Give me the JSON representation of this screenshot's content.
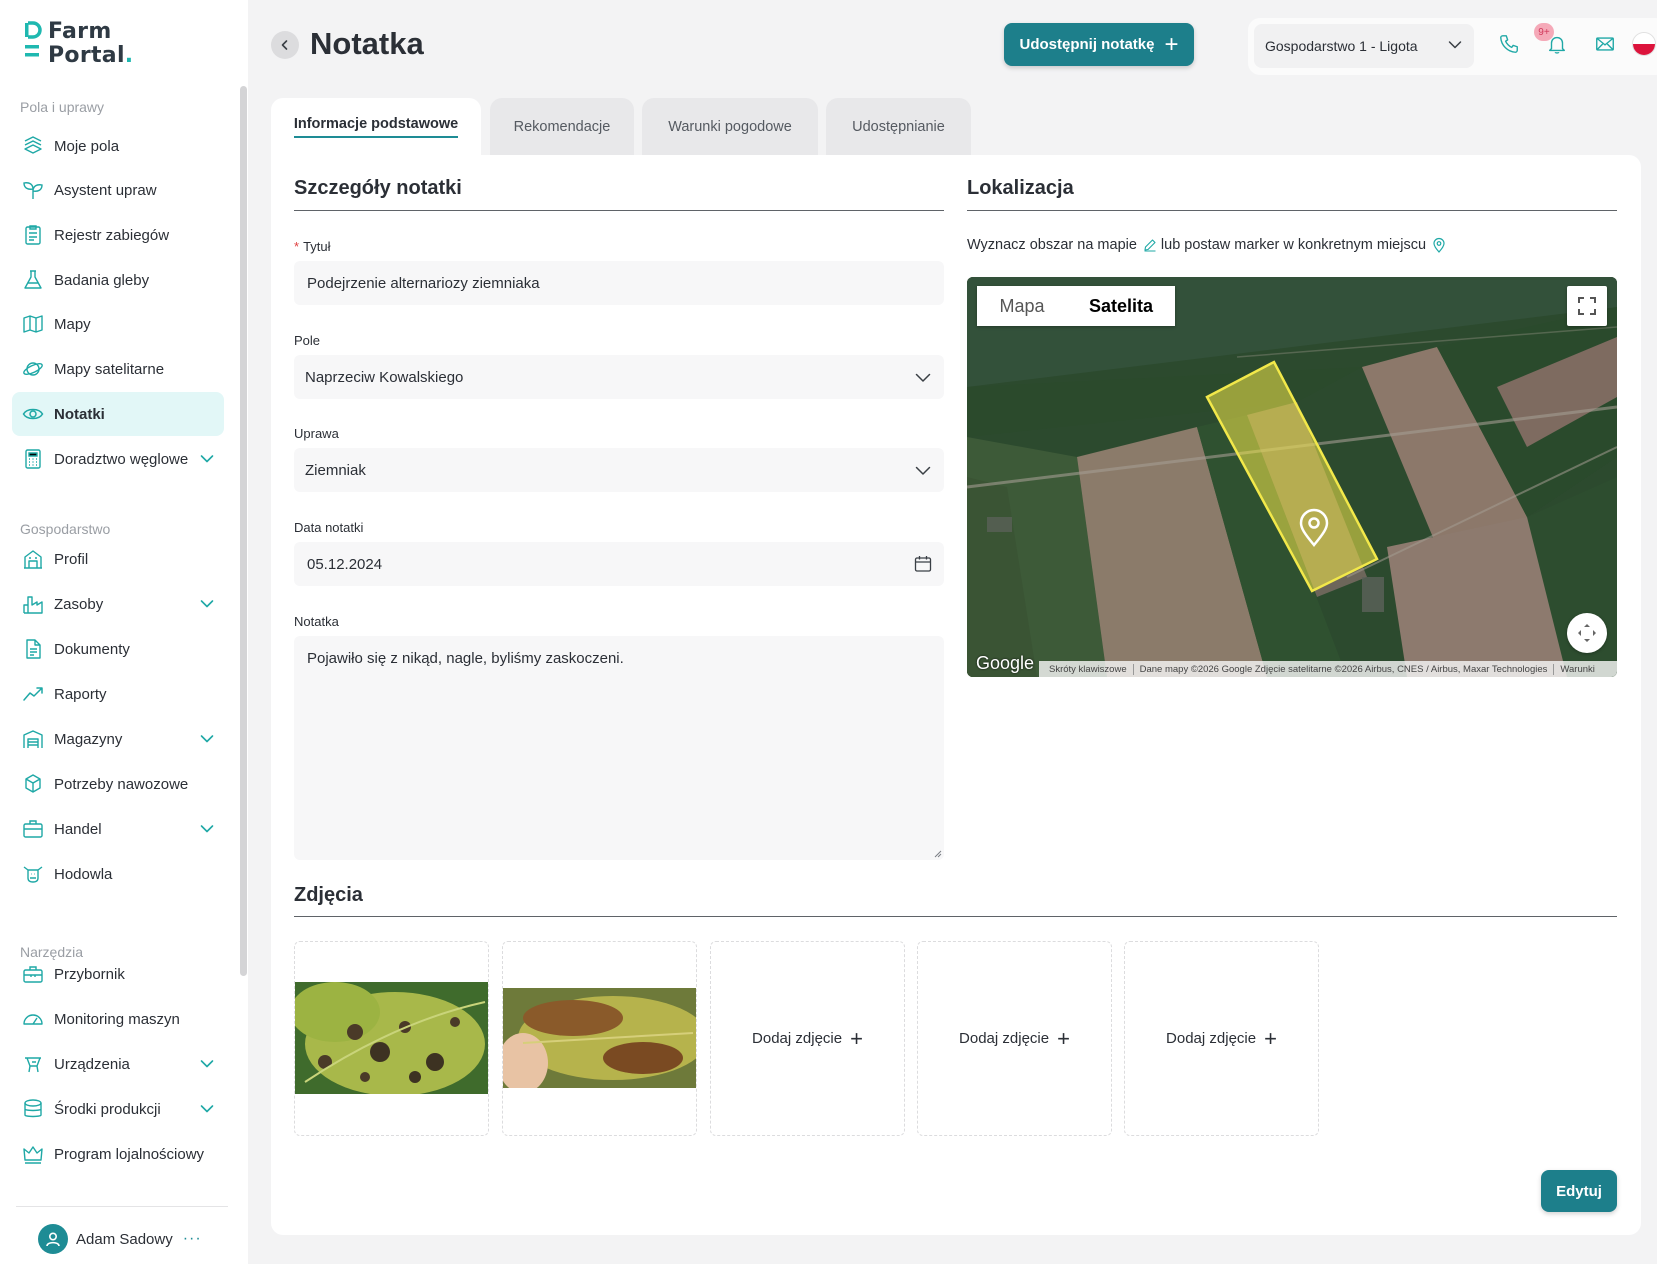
{
  "brand": {
    "line1": "Farm",
    "line2": "Portal",
    "dot": ".",
    "accent": "#1fb8b0",
    "primary": "#1d7f8b"
  },
  "sidebar": {
    "sections": [
      {
        "label": "Pola i uprawy"
      },
      {
        "label": "Gospodarstwo"
      },
      {
        "label": "Narzędzia"
      }
    ],
    "items": [
      {
        "label": "Moje pola",
        "icon": "fields-icon"
      },
      {
        "label": "Asystent upraw",
        "icon": "sprout-icon"
      },
      {
        "label": "Rejestr zabiegów",
        "icon": "clipboard-icon"
      },
      {
        "label": "Badania gleby",
        "icon": "flask-icon"
      },
      {
        "label": "Mapy",
        "icon": "map-icon"
      },
      {
        "label": "Mapy satelitarne",
        "icon": "planet-icon"
      },
      {
        "label": "Notatki",
        "icon": "eye-icon",
        "active": true
      },
      {
        "label": "Doradztwo węglowe",
        "icon": "calculator-icon",
        "expandable": true
      },
      {
        "label": "Profil",
        "icon": "building-icon"
      },
      {
        "label": "Zasoby",
        "icon": "factory-icon",
        "expandable": true
      },
      {
        "label": "Dokumenty",
        "icon": "document-icon"
      },
      {
        "label": "Raporty",
        "icon": "trend-icon"
      },
      {
        "label": "Magazyny",
        "icon": "warehouse-icon",
        "expandable": true
      },
      {
        "label": "Potrzeby nawozowe",
        "icon": "fertilizer-icon"
      },
      {
        "label": "Handel",
        "icon": "briefcase-icon",
        "expandable": true
      },
      {
        "label": "Hodowla",
        "icon": "cow-icon"
      },
      {
        "label": "Przybornik",
        "icon": "toolbox-icon"
      },
      {
        "label": "Monitoring maszyn",
        "icon": "gauge-icon"
      },
      {
        "label": "Urządzenia",
        "icon": "device-icon",
        "expandable": true
      },
      {
        "label": "Środki produkcji",
        "icon": "database-icon",
        "expandable": true
      },
      {
        "label": "Program lojalnościowy",
        "icon": "crown-icon"
      }
    ],
    "user": {
      "name": "Adam Sadowy",
      "more": "···"
    }
  },
  "header": {
    "title": "Notatka",
    "share_label": "Udostępnij notatkę",
    "share_plus": "+",
    "farm": "Gospodarstwo 1 - Ligota",
    "notifications_badge": "9+"
  },
  "tabs": [
    {
      "label": "Informacje podstawowe",
      "active": true
    },
    {
      "label": "Rekomendacje"
    },
    {
      "label": "Warunki pogodowe"
    },
    {
      "label": "Udostępnianie"
    }
  ],
  "details": {
    "title": "Szczegóły notatki",
    "required_mark": "*",
    "title_label": "Tytuł",
    "title_value": "Podejrzenie alternariozy ziemniaka",
    "field_label": "Pole",
    "field_value": "Naprzeciw Kowalskiego",
    "crop_label": "Uprawa",
    "crop_value": "Ziemniak",
    "date_label": "Data notatki",
    "date_value": "05.12.2024",
    "note_label": "Notatka",
    "note_value": "Pojawiło się z nikąd, nagle, byliśmy zaskoczeni."
  },
  "location": {
    "title": "Lokalizacja",
    "hint_part1": "Wyznacz obszar na mapie",
    "hint_part2": "lub postaw marker w konkretnym miejscu",
    "map": {
      "toggle_map": "Mapa",
      "toggle_satellite": "Satelita",
      "selected": "Satelita",
      "logo": "Google",
      "attribution": [
        "Skróty klawiszowe",
        "Dane mapy ©2026 Google Zdjęcie satelitarne ©2026 Airbus, CNES / Airbus, Maxar Technologies",
        "Warunki"
      ],
      "polygon_color": "#f2e84a"
    }
  },
  "photos": {
    "title": "Zdjęcia",
    "add_label": "Dodaj zdjęcie",
    "add_plus": "+",
    "items": [
      {
        "type": "photo",
        "subject": "potato leaf with dark spots"
      },
      {
        "type": "photo",
        "subject": "leaf with brown lesion"
      },
      {
        "type": "add"
      },
      {
        "type": "add"
      },
      {
        "type": "add"
      }
    ]
  },
  "actions": {
    "edit_label": "Edytuj"
  }
}
